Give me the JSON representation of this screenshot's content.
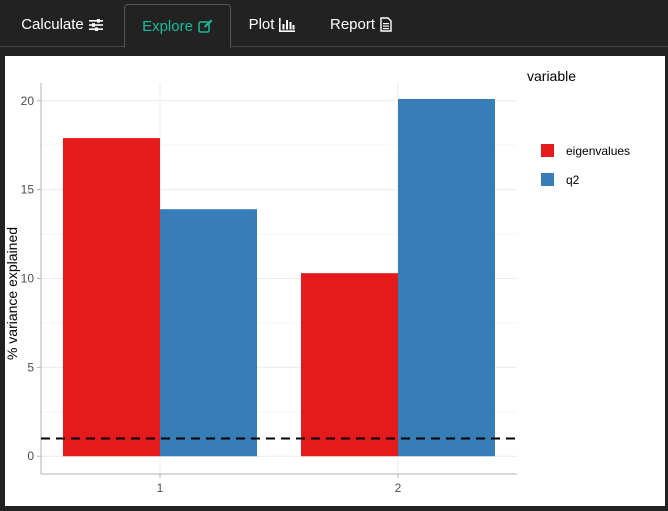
{
  "tabs": [
    {
      "label": "Calculate",
      "icon": "sliders-icon",
      "active": false
    },
    {
      "label": "Explore",
      "icon": "edit-icon",
      "active": true
    },
    {
      "label": "Plot",
      "icon": "bar-chart-icon",
      "active": false
    },
    {
      "label": "Report",
      "icon": "document-icon",
      "active": false
    }
  ],
  "colors": {
    "accent": "#18bc9c",
    "eigenvalues": "#e41a1c",
    "q2": "#377eb8",
    "background": "#222222"
  },
  "chart_data": {
    "type": "bar",
    "categories": [
      "1",
      "2"
    ],
    "series": [
      {
        "name": "eigenvalues",
        "values": [
          17.9,
          10.3
        ]
      },
      {
        "name": "q2",
        "values": [
          13.9,
          20.1
        ]
      }
    ],
    "title": "",
    "xlabel": "",
    "ylabel": "% variance explained",
    "ylim": [
      -1,
      21
    ],
    "yticks": [
      0,
      5,
      10,
      15,
      20
    ],
    "reference_line": {
      "y": 1,
      "style": "dashed"
    },
    "legend": {
      "title": "variable",
      "position": "right"
    },
    "grid": true
  }
}
